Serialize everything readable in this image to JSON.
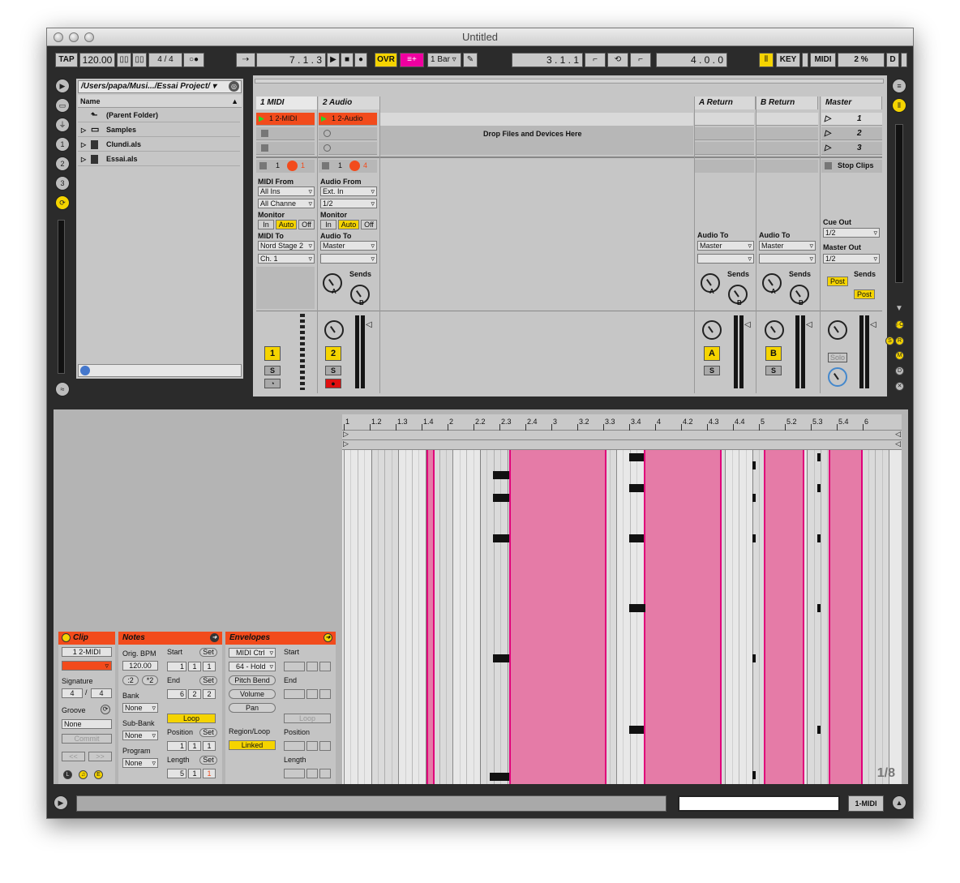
{
  "window": {
    "title": "Untitled"
  },
  "control_bar": {
    "tap": "TAP",
    "tempo": "120.00",
    "signature_num": "4",
    "signature_sep": "/",
    "signature_den": "4",
    "arrangement_position": "7 .  1 .  3",
    "ovr": "OVR",
    "quantize": "1 Bar",
    "loop_start": "3 .  1 .  1",
    "loop_length": "4 .  0 .  0",
    "key": "KEY",
    "midi": "MIDI",
    "cpu": "2 %",
    "d": "D"
  },
  "browser": {
    "path": "/Users/papa/Musi.../Essai Project/",
    "column_header": "Name",
    "items": [
      {
        "label": "(Parent Folder)",
        "icon": "parent-folder-icon"
      },
      {
        "label": "Samples",
        "icon": "folder-icon"
      },
      {
        "label": "Clundi.als",
        "icon": "live-set-icon"
      },
      {
        "label": "Essai.als",
        "icon": "live-set-icon"
      }
    ]
  },
  "session": {
    "tracks": [
      {
        "name": "1 MIDI",
        "clip": "1 2-MIDI",
        "num": "1",
        "route_from_label": "MIDI From",
        "from": "All Ins",
        "channel": "All Channe",
        "monitor_label": "Monitor",
        "route_to_label": "MIDI To",
        "to": "Nord Stage 2",
        "to_channel": "Ch. 1",
        "slot_num": "1",
        "activator_val": "1"
      },
      {
        "name": "2 Audio",
        "clip": "1 2-Audio",
        "num": "2",
        "route_from_label": "Audio From",
        "from": "Ext. In",
        "channel": "1/2",
        "monitor_label": "Monitor",
        "route_to_label": "Audio To",
        "to": "Master",
        "slot_num": "1",
        "activator_val": "4"
      }
    ],
    "returns": [
      {
        "name": "A Return",
        "letter": "A",
        "route_to_label": "Audio To",
        "to": "Master"
      },
      {
        "name": "B Return",
        "letter": "B",
        "route_to_label": "Audio To",
        "to": "Master"
      }
    ],
    "master": {
      "name": "Master",
      "scenes": [
        "1",
        "2",
        "3"
      ],
      "stop_clips": "Stop Clips",
      "cue_out_label": "Cue Out",
      "cue_out": "1/2",
      "master_out_label": "Master Out",
      "master_out": "1/2",
      "post": "Post",
      "solo": "Solo"
    },
    "drop_text": "Drop Files and Devices Here",
    "monitor_in": "In",
    "monitor_auto": "Auto",
    "monitor_off": "Off",
    "sends": "Sends",
    "s": "S",
    "knob_a": "A",
    "knob_b": "B"
  },
  "clip_view": {
    "clip": {
      "title": "Clip",
      "name": "1 2-MIDI",
      "signature_label": "Signature",
      "sig_num": "4",
      "sig_den": "4",
      "groove_label": "Groove",
      "groove": "None",
      "commit": "Commit",
      "prev": "<<",
      "next": ">>"
    },
    "notes": {
      "title": "Notes",
      "orig_bpm_label": "Orig. BPM",
      "orig_bpm": "120.00",
      "half": ":2",
      "dbl": "*2",
      "bank_label": "Bank",
      "bank": "None",
      "subbank_label": "Sub-Bank",
      "subbank": "None",
      "program_label": "Program",
      "program": "None",
      "start_label": "Start",
      "set": "Set",
      "start": [
        "1",
        "1",
        "1"
      ],
      "end_label": "End",
      "end": [
        "6",
        "2",
        "2"
      ],
      "loop": "Loop",
      "position_label": "Position",
      "position": [
        "1",
        "1",
        "1"
      ],
      "length_label": "Length",
      "length": [
        "5",
        "1",
        "1"
      ]
    },
    "envelopes": {
      "title": "Envelopes",
      "device": "MIDI Ctrl",
      "control": "64 - Hold",
      "pitch_bend": "Pitch Bend",
      "volume": "Volume",
      "pan": "Pan",
      "region_label": "Region/Loop",
      "linked": "Linked",
      "start_label": "Start",
      "end_label": "End",
      "loop": "Loop",
      "position_label": "Position",
      "length_label": "Length"
    },
    "ruler": [
      "1",
      "1.2",
      "1.3",
      "1.4",
      "2",
      "2.2",
      "2.3",
      "2.4",
      "3",
      "3.2",
      "3.3",
      "3.4",
      "4",
      "4.2",
      "4.3",
      "4.4",
      "5",
      "5.2",
      "5.3",
      "5.4",
      "6"
    ],
    "grid": "1/8"
  },
  "status": {
    "selected_track": "1-MIDI"
  },
  "colors": {
    "accent_yellow": "#f5d400",
    "clip_red": "#f24b1c",
    "loop_pink": "#e57ba7",
    "ovr_pink": "#f000a0"
  }
}
